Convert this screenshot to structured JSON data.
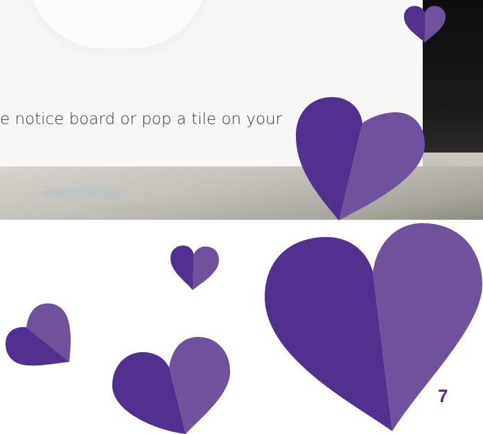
{
  "page": {
    "body_text": "e notice board or pop a tile on your",
    "page_number": "7"
  },
  "colors": {
    "heart_dark": "#52308f",
    "heart_light": "#6f519d",
    "card": "#f7f7f6",
    "text": "#3a3a3a"
  },
  "icons": [
    "heart-icon"
  ]
}
